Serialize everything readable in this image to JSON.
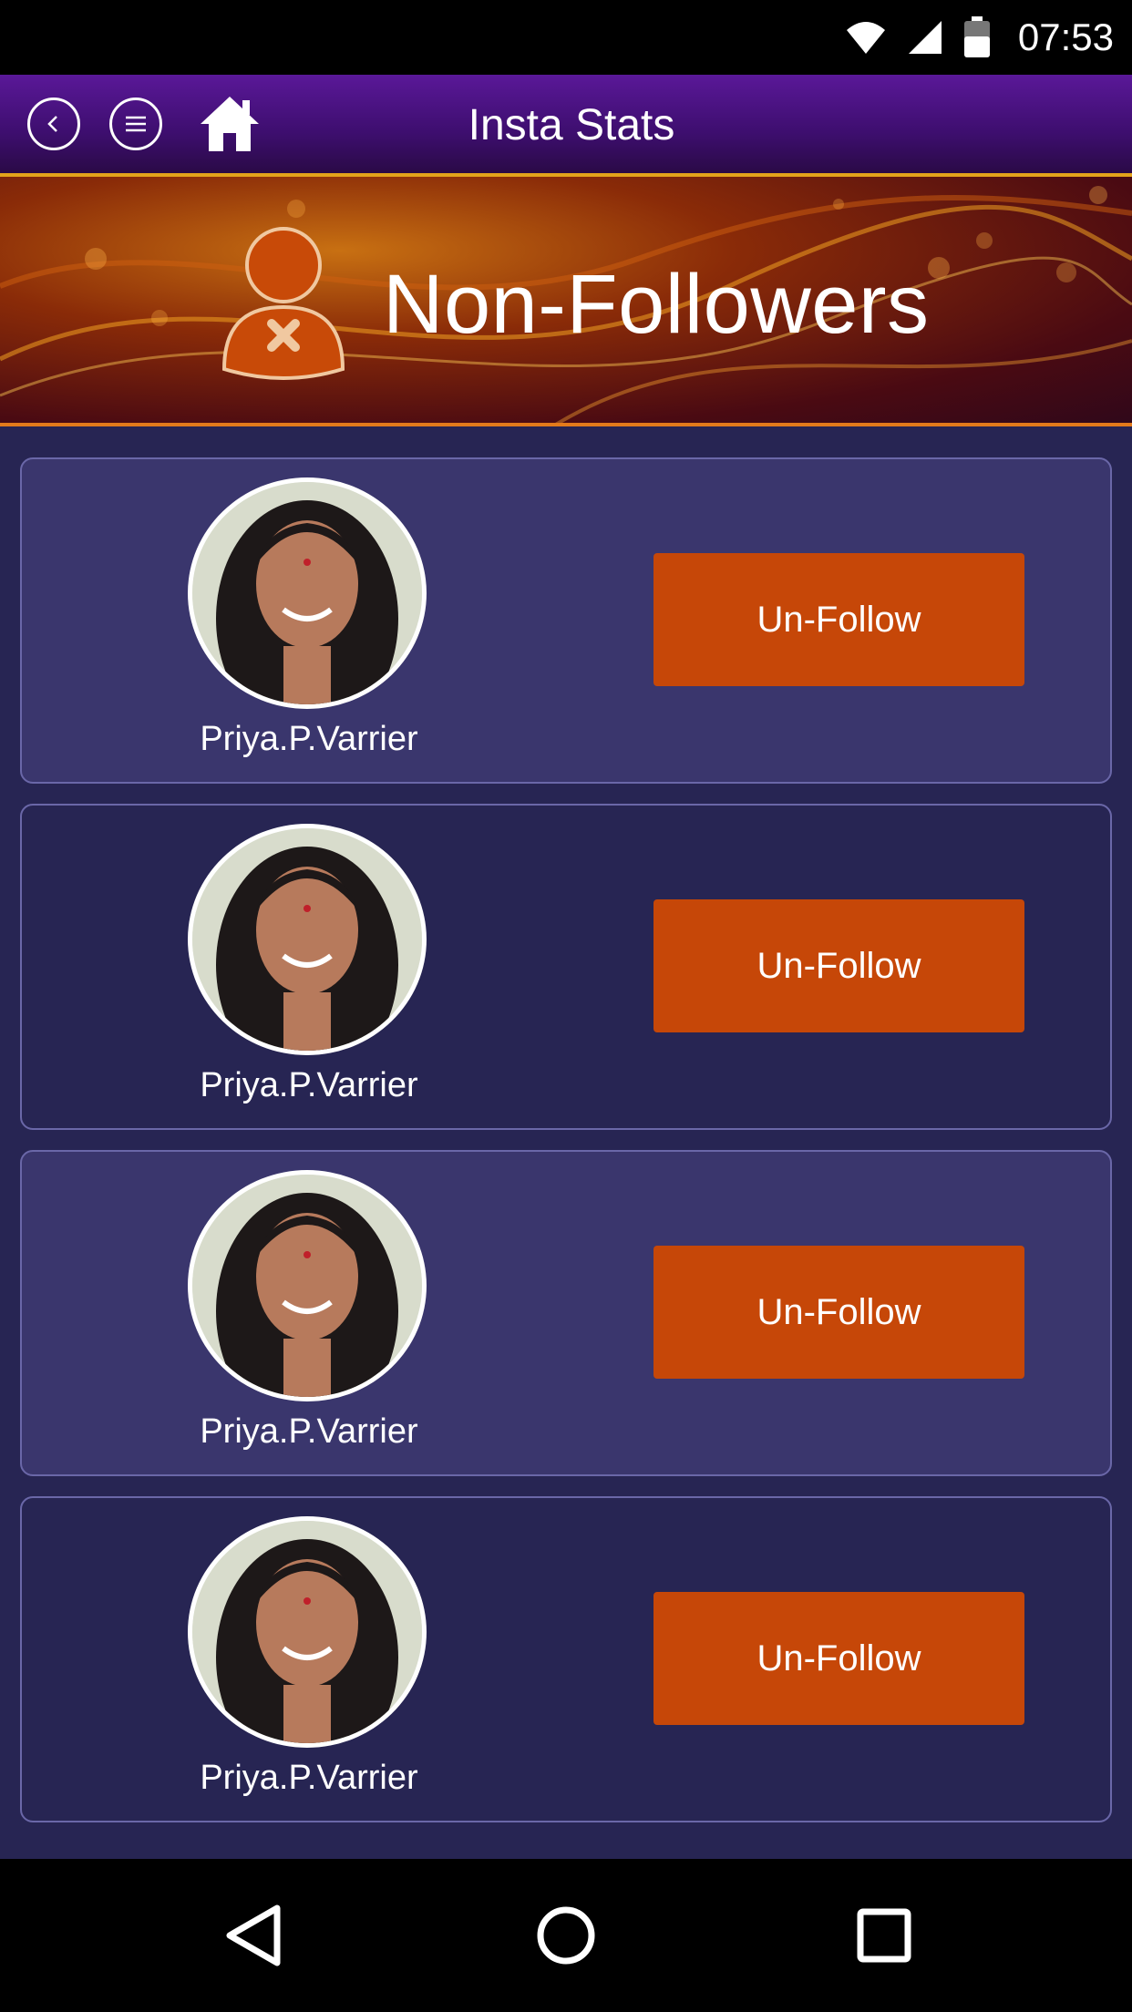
{
  "status_bar": {
    "time": "07:53",
    "icons": [
      "wifi-icon",
      "signal-icon",
      "battery-icon"
    ]
  },
  "app_bar": {
    "title": "Insta Stats",
    "icons": [
      "back-icon",
      "menu-icon",
      "home-icon"
    ]
  },
  "banner": {
    "heading": "Non-Followers",
    "icon": "user-remove-icon"
  },
  "list": {
    "items": [
      {
        "name": "Priya.P.Varrier",
        "button_label": "Un-Follow"
      },
      {
        "name": "Priya.P.Varrier",
        "button_label": "Un-Follow"
      },
      {
        "name": "Priya.P.Varrier",
        "button_label": "Un-Follow"
      },
      {
        "name": "Priya.P.Varrier",
        "button_label": "Un-Follow"
      }
    ]
  },
  "nav_bar": {
    "icons": [
      "back-triangle-icon",
      "home-circle-icon",
      "recents-square-icon"
    ]
  },
  "colors": {
    "app_bar": "#4b1283",
    "content_bg": "#272553",
    "card_light": "#3a366d",
    "button": "#c64708",
    "banner_accent": "#e3a31b"
  }
}
